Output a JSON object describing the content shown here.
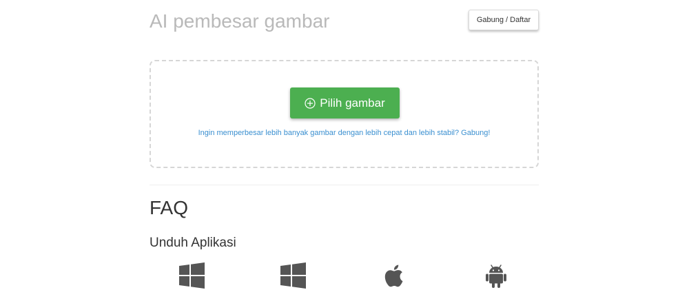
{
  "header": {
    "title": "AI pembesar gambar",
    "auth_label": "Gabung / Daftar"
  },
  "upload": {
    "pick_label": "Pilih gambar",
    "pick_icon": "plus-circle-icon",
    "join_prompt": "Ingin memperbesar lebih banyak gambar dengan lebih cepat dan lebih stabil? Gabung!"
  },
  "faq": {
    "title": "FAQ"
  },
  "apps": {
    "title": "Unduh Aplikasi",
    "items": [
      {
        "icon": "windows-icon"
      },
      {
        "icon": "windows-icon"
      },
      {
        "icon": "apple-icon"
      },
      {
        "icon": "android-icon"
      }
    ]
  },
  "colors": {
    "accent_green": "#4caf50",
    "link_blue": "#3a8fd0",
    "title_gray": "#b9b9b9",
    "icon_gray": "#555555"
  }
}
